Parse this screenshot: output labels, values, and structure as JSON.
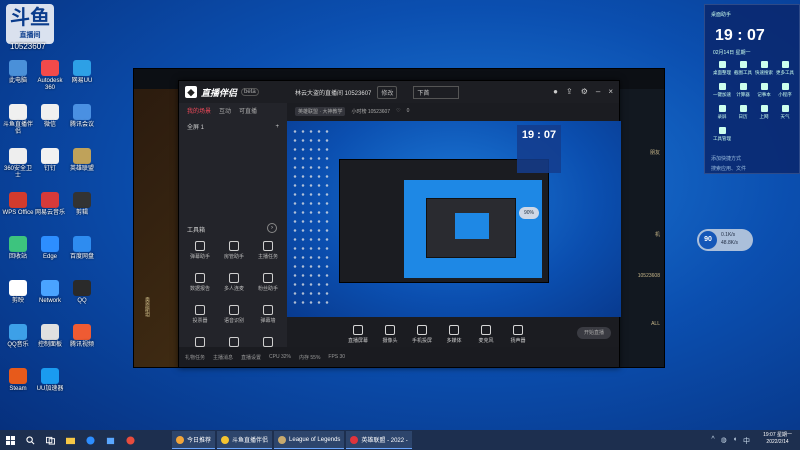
{
  "overlay": {
    "logo_text": "斗鱼",
    "logo_sub": "直播间",
    "room_id": "10523607"
  },
  "desktop_icons": [
    {
      "label": "此电脑",
      "color": "#4a90d9"
    },
    {
      "label": "斗鱼直播伴侣",
      "color": "#f0f0f0"
    },
    {
      "label": "360安全卫士",
      "color": "#eeeeee"
    },
    {
      "label": "WPS Office",
      "color": "#d23b2d"
    },
    {
      "label": "回收站",
      "color": "#3dc47e"
    },
    {
      "label": "剪映",
      "color": "#ffffff"
    },
    {
      "label": "QQ音乐",
      "color": "#3da0e8"
    },
    {
      "label": "Steam",
      "color": "#e75a1b"
    },
    {
      "label": "Autodesk 360",
      "color": "#f24a4a"
    },
    {
      "label": "微信",
      "color": "#f0f0f0"
    },
    {
      "label": "钉钉",
      "color": "#f2f2f2"
    },
    {
      "label": "网易云音乐",
      "color": "#d73a3a"
    },
    {
      "label": "Edge",
      "color": "#2d8eff"
    },
    {
      "label": "Network",
      "color": "#4aa3ff"
    },
    {
      "label": "控制面板",
      "color": "#e0e0e0"
    },
    {
      "label": "UU加速器",
      "color": "#1a9bf0"
    },
    {
      "label": "网易UU",
      "color": "#2da0e6"
    },
    {
      "label": "腾讯会议",
      "color": "#4a90e2"
    },
    {
      "label": "英雄联盟",
      "color": "#bfa25a"
    },
    {
      "label": "剪辑",
      "color": "#333333"
    },
    {
      "label": "百度网盘",
      "color": "#2e8cf0"
    },
    {
      "label": "QQ",
      "color": "#2a2a2a"
    },
    {
      "label": "腾讯视频",
      "color": "#ef5b33"
    }
  ],
  "lol_window": {
    "right_lines": [
      "朋友",
      "机",
      "10523608",
      "ALL"
    ],
    "vertical_text": "奥恩斯坦"
  },
  "app": {
    "logo_text": "直播伴侣",
    "version": "beta",
    "tabs": [
      {
        "label": "我的场景",
        "active": true
      },
      {
        "label": "互动"
      },
      {
        "label": "可直播"
      }
    ],
    "scene_label": "全屏 1",
    "room_title": "林云大盗的直播间 10523607",
    "edit_label": "修改",
    "live_title_placeholder": "下首",
    "sub_top": {
      "category": "英雄联盟 · 大神教学",
      "viewers": "小时榜 10523607",
      "likes": "0"
    },
    "tools_title": "工具箱",
    "tools_more": "›",
    "tools": [
      {
        "label": "弹幕助手"
      },
      {
        "label": "房管助手"
      },
      {
        "label": "主播任务"
      },
      {
        "label": "数据报告"
      },
      {
        "label": "多人连麦"
      },
      {
        "label": "粉丝助手"
      },
      {
        "label": "投票器"
      },
      {
        "label": "语音识别"
      },
      {
        "label": "弹幕墙"
      },
      {
        "label": "互动玩法"
      },
      {
        "label": "直播PK"
      },
      {
        "label": "礼物特效"
      }
    ],
    "preview": {
      "nested_clock": "19 : 07",
      "badge": "90%"
    },
    "bottom_bar": [
      {
        "label": "直播屏幕"
      },
      {
        "label": "摄像头"
      },
      {
        "label": "手机投屏"
      },
      {
        "label": "多媒体"
      },
      {
        "label": "麦克风"
      },
      {
        "label": "扬声器"
      }
    ],
    "start_live": "开始直播",
    "status_bar": [
      "礼物任务",
      "主播消息",
      "直播设置",
      "CPU 32%",
      "内存 55%",
      "FPS 30"
    ]
  },
  "speed_widget": {
    "percent": "90",
    "up": "0.1K/s",
    "down": "48.8K/s"
  },
  "right_panel": {
    "title": "桌面助手",
    "clock": "19 : 07",
    "date": "02月14日 星期一",
    "items": [
      {
        "label": "桌面整理"
      },
      {
        "label": "截图工具"
      },
      {
        "label": "快速搜索"
      },
      {
        "label": "更多工具"
      },
      {
        "label": "一键加速"
      },
      {
        "label": "计算器"
      },
      {
        "label": "记事本"
      },
      {
        "label": "小程序"
      },
      {
        "label": "录屏"
      },
      {
        "label": "日历"
      },
      {
        "label": "上网"
      },
      {
        "label": "天气"
      },
      {
        "label": "工具管理"
      }
    ],
    "note1": "添加快捷方式",
    "note2": "搜索应用、文件"
  },
  "taskbar": {
    "apps": [
      {
        "label": "今日推荐",
        "color": "#f2a53a"
      },
      {
        "label": "斗鱼直播伴侣",
        "color": "#f4c430"
      },
      {
        "label": "League of Legends",
        "color": "#c8aa6e"
      },
      {
        "label": "英雄联盟 - 2022 -",
        "color": "#e0343c"
      }
    ],
    "time": "19:07 星期一",
    "date": "2022/2/14"
  }
}
